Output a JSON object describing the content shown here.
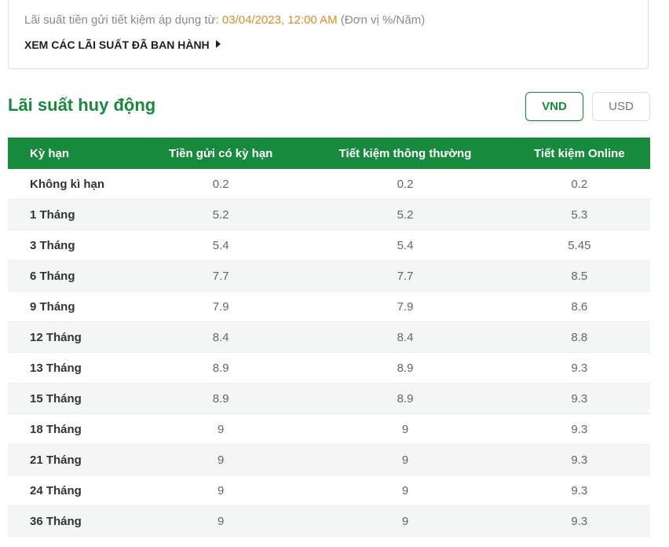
{
  "notice": {
    "prefix": "Lãi suất tiền gửi tiết kiệm áp dụng từ: ",
    "date": "03/04/2023, 12:00 AM",
    "unit": " (Đơn vị %/Năm)",
    "link_label": "XEM CÁC LÃI SUẤT ĐÃ BAN HÀNH"
  },
  "section": {
    "title": "Lãi suất huy động"
  },
  "currency": {
    "vnd": "VND",
    "usd": "USD",
    "selected": "VND"
  },
  "colors": {
    "brand_green": "#178a3e",
    "date_orange": "#e08b2c"
  },
  "table": {
    "headers": [
      "Kỳ hạn",
      "Tiền gửi có kỳ hạn",
      "Tiết kiệm thông thường",
      "Tiết kiệm Online"
    ],
    "rows": [
      [
        "Không kì hạn",
        "0.2",
        "0.2",
        "0.2"
      ],
      [
        "1 Tháng",
        "5.2",
        "5.2",
        "5.3"
      ],
      [
        "3 Tháng",
        "5.4",
        "5.4",
        "5.45"
      ],
      [
        "6 Tháng",
        "7.7",
        "7.7",
        "8.5"
      ],
      [
        "9 Tháng",
        "7.9",
        "7.9",
        "8.6"
      ],
      [
        "12 Tháng",
        "8.4",
        "8.4",
        "8.8"
      ],
      [
        "13 Tháng",
        "8.9",
        "8.9",
        "9.3"
      ],
      [
        "15 Tháng",
        "8.9",
        "8.9",
        "9.3"
      ],
      [
        "18 Tháng",
        "9",
        "9",
        "9.3"
      ],
      [
        "21 Tháng",
        "9",
        "9",
        "9.3"
      ],
      [
        "24 Tháng",
        "9",
        "9",
        "9.3"
      ],
      [
        "36 Tháng",
        "9",
        "9",
        "9.3"
      ]
    ]
  }
}
